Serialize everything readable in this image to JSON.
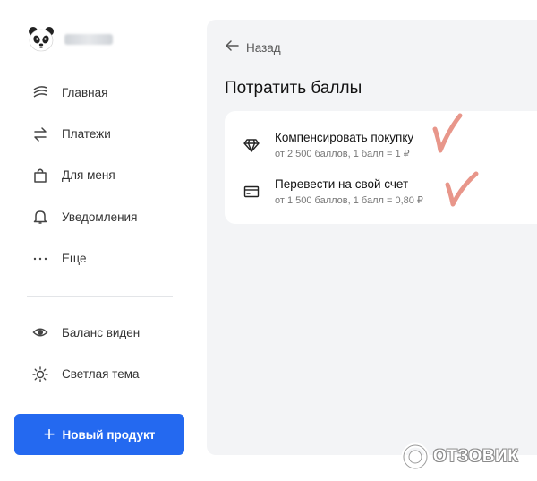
{
  "sidebar": {
    "items": [
      {
        "label": "Главная",
        "icon": "home-waves-icon"
      },
      {
        "label": "Платежи",
        "icon": "transfer-arrows-icon"
      },
      {
        "label": "Для меня",
        "icon": "shopping-bag-icon"
      },
      {
        "label": "Уведомления",
        "icon": "bell-icon"
      },
      {
        "label": "Еще",
        "icon": "more-dots-icon"
      }
    ],
    "settings": [
      {
        "label": "Баланс виден",
        "icon": "eye-icon"
      },
      {
        "label": "Светлая тема",
        "icon": "sun-icon"
      }
    ],
    "new_product_label": "Новый продукт"
  },
  "main": {
    "back_label": "Назад",
    "title": "Потратить баллы",
    "options": [
      {
        "title": "Компенсировать покупку",
        "subtitle": "от 2 500 баллов, 1 балл = 1 ₽",
        "icon": "diamond-icon"
      },
      {
        "title": "Перевести на свой счет",
        "subtitle": "от 1 500 баллов, 1 балл = 0,80 ₽",
        "icon": "card-icon"
      }
    ]
  },
  "watermark": {
    "text": "ОТЗОВИК"
  },
  "colors": {
    "accent": "#2469f0",
    "panel_bg": "#f3f4f6",
    "check_marks": "#e8968a"
  }
}
